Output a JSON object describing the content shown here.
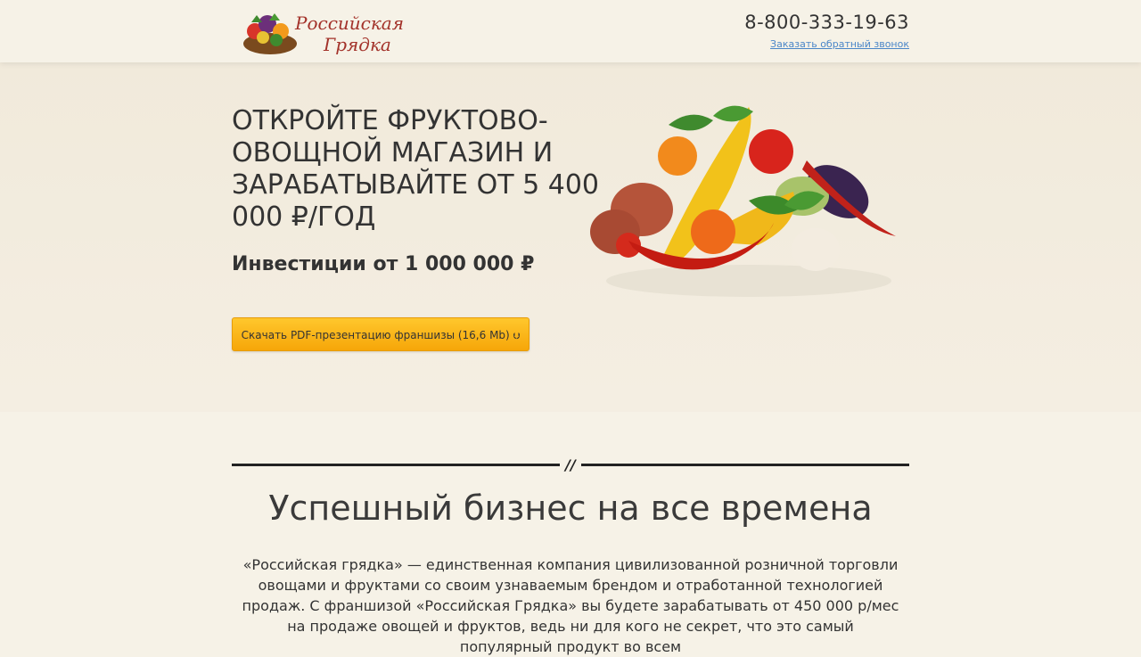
{
  "header": {
    "logo_text_line1": "Российская",
    "logo_text_line2": "Грядка",
    "phone": "8-800-333-19-63",
    "callback_link": "Заказать обратный звонок"
  },
  "hero": {
    "title": "ОТКРОЙТЕ ФРУКТОВО-ОВОЩНОЙ МАГАЗИН И ЗАРАБАТЫВАЙТЕ ОТ 5 400 000 ₽/ГОД",
    "investment": "Инвестиции от 1 000 000 ₽",
    "cta_label": "Скачать PDF-презентацию франшизы (16,6 Mb)",
    "cta_icon": "download-arrow-icon"
  },
  "section": {
    "divider_symbol": "//",
    "title": "Успешный бизнес на все времена",
    "text": "«Российская грядка» — единственная компания цивилизованной розничной торговли овощами и фруктами со своим узнаваемым брендом и отработанной технологией продаж. С франшизой «Российская Грядка» вы будете зарабатывать от 450 000 р/мес на продаже овощей и фруктов, ведь ни для кого не секрет, что это самый популярный продукт во всем"
  },
  "colors": {
    "background": "#f6f2e7",
    "cta_top": "#ffc72d",
    "cta_bottom": "#f6a609",
    "logo_red": "#a3322a",
    "link_blue": "#4a86c8"
  }
}
